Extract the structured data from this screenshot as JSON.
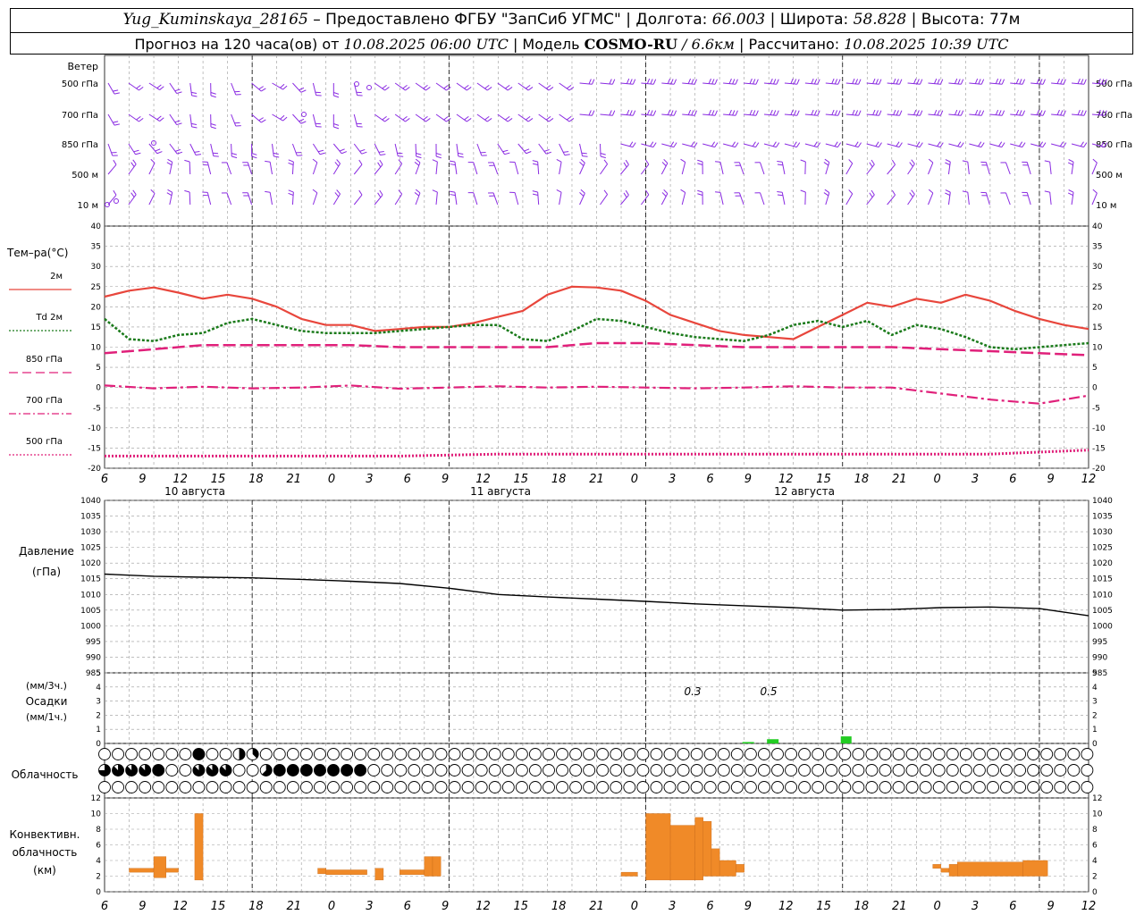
{
  "header": {
    "station": "Yug_Kuminskaya_28165",
    "provider": "– Предоставлено ФГБУ \"ЗапСиб УГМС\"",
    "lon_label": "Долгота:",
    "lon": "66.003",
    "lat_label": "Широта:",
    "lat": "58.828",
    "alt_label": "Высота:",
    "alt": "77м",
    "forecast_prefix": "Прогноз на 120 часа(ов) от",
    "forecast_start": "10.08.2025 06:00 UTC",
    "model_label": "Модель",
    "model_name": "COSMO-RU",
    "model_res": "/ 6.6км",
    "calc_label": "Рассчитано:",
    "calc_time": "10.08.2025 10:39 UTC",
    "sep": "|"
  },
  "colors": {
    "temp2m": "#e8463c",
    "td2m": "#1a7a1a",
    "t850": "#e0207a",
    "t700": "#e0207a",
    "t500": "#e0207a",
    "wind": "#8a2be2",
    "pressure": "#000000",
    "precip": "#22cc22",
    "convective": "#f08a28",
    "grid": "#999999"
  },
  "x_axis": {
    "tick_labels": [
      "6",
      "9",
      "12",
      "15",
      "18",
      "21",
      "0",
      "3",
      "6",
      "9",
      "12",
      "15",
      "18",
      "21",
      "0",
      "3",
      "6",
      "9",
      "12",
      "15",
      "18",
      "21",
      "0",
      "3",
      "6",
      "9",
      "12"
    ],
    "date_labels": [
      "10 августа",
      "11 августа",
      "12 августа"
    ]
  },
  "wind_panel": {
    "title": "Ветер",
    "levels": [
      "500 гПа",
      "700 гПа",
      "850 гПа",
      "500 м",
      "10 м"
    ],
    "icon": "wind-barb-icon"
  },
  "cloud_panel": {
    "title": "Облачность",
    "icon": "cloud-cover-circle-icon",
    "rows": [
      "0000000800430000000000000000000000000000000000000000000000000000000000000000000000008768888800466888788460000000070000000000000000000",
      "6777800777005888888800000000000000000000000000000000000000000000000000000000000000000887876000000000000000000000000000000560000004545",
      "0000000000000000000000000000000000000000000000000000000000000000000000000000000000000008862018870000000000000000000000000000000000004"
    ]
  },
  "chart_data": [
    {
      "type": "line",
      "title": "Тем–ра(°С)",
      "ylim": [
        -20,
        40
      ],
      "yticks": [
        -20,
        -15,
        -10,
        -5,
        0,
        5,
        10,
        15,
        20,
        25,
        30,
        35,
        40
      ],
      "x_unit": "hours from 10.08.2025 06:00 UTC",
      "series": [
        {
          "name": "2м",
          "style": "solid",
          "x": [
            0,
            3,
            6,
            9,
            12,
            15,
            18,
            21,
            24,
            27,
            30,
            33,
            36,
            39,
            42,
            45,
            48,
            51,
            54,
            57,
            60,
            63,
            66,
            69,
            72,
            75,
            78,
            81,
            84,
            87,
            90,
            93,
            96,
            99,
            102,
            105,
            108,
            111,
            114,
            117,
            120
          ],
          "values": [
            22.5,
            24,
            24.8,
            23.5,
            22,
            23,
            22,
            20,
            17,
            15.5,
            15.5,
            14,
            14.5,
            15,
            15,
            16,
            17.5,
            19,
            23,
            25,
            24.8,
            24,
            21.5,
            18,
            16,
            14,
            13,
            12.5,
            12,
            15,
            18,
            21,
            20,
            22,
            21,
            23,
            21.5,
            19,
            17,
            15.5,
            14.5
          ]
        },
        {
          "name": "Td  2м",
          "style": "dotted",
          "x": [
            0,
            3,
            6,
            9,
            12,
            15,
            18,
            21,
            24,
            27,
            30,
            33,
            36,
            39,
            42,
            45,
            48,
            51,
            54,
            57,
            60,
            63,
            66,
            69,
            72,
            75,
            78,
            81,
            84,
            87,
            90,
            93,
            96,
            99,
            102,
            105,
            108,
            111,
            114,
            117,
            120
          ],
          "values": [
            17,
            12,
            11.5,
            13,
            13.5,
            16,
            17,
            15.5,
            14,
            13.5,
            13.5,
            13.5,
            14,
            14.5,
            15,
            15.5,
            15.5,
            12,
            11.5,
            14,
            17,
            16.5,
            15,
            13.5,
            12.5,
            12,
            11.5,
            13,
            15.5,
            16.5,
            15,
            16.5,
            13,
            15.5,
            14.5,
            12.5,
            10,
            9.5,
            10,
            10.5,
            11
          ]
        },
        {
          "name": "850 гПа",
          "style": "dashed",
          "x": [
            0,
            6,
            12,
            18,
            24,
            30,
            36,
            42,
            48,
            54,
            60,
            66,
            72,
            78,
            84,
            90,
            96,
            102,
            108,
            114,
            120
          ],
          "values": [
            8.5,
            9.5,
            10.5,
            10.5,
            10.5,
            10.5,
            10,
            10,
            10,
            10,
            11,
            11,
            10.5,
            10,
            10,
            10,
            10,
            9.5,
            9,
            8.5,
            8
          ]
        },
        {
          "name": "700 гПа",
          "style": "dashdot",
          "x": [
            0,
            6,
            12,
            18,
            24,
            30,
            36,
            42,
            48,
            54,
            60,
            66,
            72,
            78,
            84,
            90,
            96,
            102,
            108,
            114,
            120
          ],
          "values": [
            0.5,
            -0.2,
            0.2,
            -0.2,
            0,
            0.5,
            -0.3,
            0,
            0.3,
            0,
            0.2,
            0,
            -0.2,
            0,
            0.3,
            0,
            0,
            -1.5,
            -3,
            -4,
            -2
          ]
        },
        {
          "name": "500 гПа",
          "style": "dotted",
          "x": [
            0,
            12,
            24,
            36,
            48,
            60,
            72,
            84,
            96,
            108,
            120
          ],
          "values": [
            -17,
            -17,
            -17,
            -17,
            -16.5,
            -16.5,
            -16.5,
            -16.5,
            -16.5,
            -16.5,
            -15.5
          ]
        }
      ]
    },
    {
      "type": "line",
      "title": "Давление",
      "ylabel": "(гПа)",
      "ylim": [
        985,
        1040
      ],
      "yticks": [
        985,
        990,
        995,
        1000,
        1005,
        1010,
        1015,
        1020,
        1025,
        1030,
        1035,
        1040
      ],
      "x": [
        0,
        6,
        12,
        18,
        24,
        30,
        36,
        42,
        48,
        54,
        60,
        66,
        72,
        78,
        84,
        90,
        96,
        102,
        108,
        114,
        120
      ],
      "series": [
        {
          "name": "Давление",
          "values": [
            1016.5,
            1015.8,
            1015.5,
            1015.3,
            1014.8,
            1014.2,
            1013.5,
            1012,
            1010,
            1009.2,
            1008.5,
            1007.8,
            1007,
            1006.4,
            1005.8,
            1005,
            1005.2,
            1005.8,
            1006,
            1005.5,
            1003.2
          ]
        }
      ]
    },
    {
      "type": "bar",
      "title": "Осадки",
      "ylabel": "(мм/3ч.) (мм/1ч.)",
      "ylim": [
        0,
        5
      ],
      "yticks": [
        0,
        1,
        2,
        3,
        4,
        5
      ],
      "x": [
        78,
        81,
        90
      ],
      "values": [
        0.1,
        0.3,
        0.5
      ],
      "data_labels": [
        "0.3",
        "0.5"
      ]
    },
    {
      "type": "bar",
      "title": "Конвективн. облачность",
      "ylabel": "(км)",
      "ylim": [
        0,
        12
      ],
      "yticks": [
        0,
        2,
        4,
        6,
        8,
        10,
        12
      ],
      "segments": [
        {
          "x0": 3,
          "x1": 6,
          "bottom": 2.5,
          "top": 3.0
        },
        {
          "x0": 6,
          "x1": 7.5,
          "bottom": 1.8,
          "top": 4.5
        },
        {
          "x0": 7.5,
          "x1": 9,
          "bottom": 2.5,
          "top": 3.0
        },
        {
          "x0": 11,
          "x1": 12,
          "bottom": 1.5,
          "top": 10
        },
        {
          "x0": 26,
          "x1": 27,
          "bottom": 2.3,
          "top": 3.0
        },
        {
          "x0": 27,
          "x1": 32,
          "bottom": 2.2,
          "top": 2.8
        },
        {
          "x0": 33,
          "x1": 34,
          "bottom": 1.5,
          "top": 3.0
        },
        {
          "x0": 36,
          "x1": 39,
          "bottom": 2.2,
          "top": 2.8
        },
        {
          "x0": 39,
          "x1": 40,
          "bottom": 2.0,
          "top": 4.5
        },
        {
          "x0": 40,
          "x1": 41,
          "bottom": 2.0,
          "top": 4.5
        },
        {
          "x0": 63,
          "x1": 65,
          "bottom": 2.0,
          "top": 2.5
        },
        {
          "x0": 66,
          "x1": 69,
          "bottom": 1.5,
          "top": 10
        },
        {
          "x0": 69,
          "x1": 72,
          "bottom": 1.5,
          "top": 8.5
        },
        {
          "x0": 72,
          "x1": 73,
          "bottom": 1.5,
          "top": 9.5
        },
        {
          "x0": 73,
          "x1": 74,
          "bottom": 2.0,
          "top": 9.0
        },
        {
          "x0": 74,
          "x1": 75,
          "bottom": 2.0,
          "top": 5.5
        },
        {
          "x0": 75,
          "x1": 77,
          "bottom": 2.0,
          "top": 4.0
        },
        {
          "x0": 77,
          "x1": 78,
          "bottom": 2.5,
          "top": 3.5
        },
        {
          "x0": 101,
          "x1": 102,
          "bottom": 3.0,
          "top": 3.5
        },
        {
          "x0": 102,
          "x1": 103,
          "bottom": 2.5,
          "top": 3.0
        },
        {
          "x0": 103,
          "x1": 104,
          "bottom": 2.0,
          "top": 3.5
        },
        {
          "x0": 104,
          "x1": 112,
          "bottom": 2.0,
          "top": 3.8
        },
        {
          "x0": 112,
          "x1": 115,
          "bottom": 2.0,
          "top": 4.0
        }
      ]
    }
  ]
}
